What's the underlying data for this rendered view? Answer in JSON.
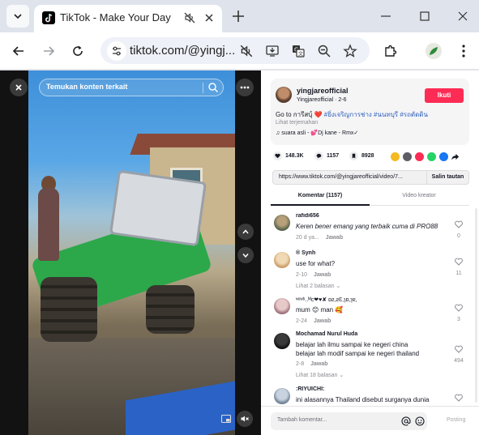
{
  "browser": {
    "tab_title": "TikTok - Make Your Day",
    "url": "tiktok.com/@yingj..."
  },
  "video": {
    "search_placeholder": "Temukan konten terkait"
  },
  "post": {
    "author": "yingjareofficial",
    "author_sub": "Yingjareofficial · 2-6",
    "follow_label": "Ikuti",
    "caption_text": "Go to การีสบุ์ ❤️ ",
    "caption_tags": "#ยิ่งเจริญการช่าง #นนทบุรี #รถตัดดิน",
    "translate": "Lihat terjemahan",
    "music": "♫  suara asli - 💕Dj kane - Rmx✓"
  },
  "stats": {
    "likes": "148.3K",
    "comments": "1157",
    "saves": "8928"
  },
  "link": {
    "url": "https://www.tiktok.com/@yingjareofficial/video/7...",
    "copy_label": "Salin tautan"
  },
  "tabs": {
    "comments": "Komentar (1157)",
    "creator": "Video kreator"
  },
  "comments": [
    {
      "user": "rafidi656",
      "text": "Keren bener emang yang terbaik cuma di PRO88",
      "time": "20 d ya...",
      "reply": "Jawab",
      "likes": "0",
      "more": ""
    },
    {
      "user": "® Synh",
      "text": "use for what?",
      "time": "2-10",
      "reply": "Jawab",
      "likes": "11",
      "more": "Lihat 2 balasan ⌄"
    },
    {
      "user": "ᶰᵉʷᵇ..ᴹᴄ❤♥✘ ɒƨ,ꙅƐ,ɿɒ,ɿɐ,",
      "text": "mum 😊 man 🥰",
      "time": "2-24",
      "reply": "Jawab",
      "likes": "3",
      "more": ""
    },
    {
      "user": "Mochamad Nurul Huda",
      "text": "belajar lah ilmu sampai ke negeri china",
      "text2": "belajar lah modif sampai ke negeri thailand",
      "time": "2-8",
      "reply": "Jawab",
      "likes": "494",
      "more": "Lihat 18 balasan ⌄"
    },
    {
      "user": ":RIYUICHI:",
      "text": "ini alasannya Thailand disebut surganya dunia",
      "time": "",
      "reply": "",
      "likes": "",
      "more": ""
    }
  ],
  "input": {
    "placeholder": "Tambah komentar...",
    "post_label": "Posting"
  },
  "colors": {
    "brand_red": "#fe2c55",
    "hashtag_blue": "#2b5db9"
  }
}
